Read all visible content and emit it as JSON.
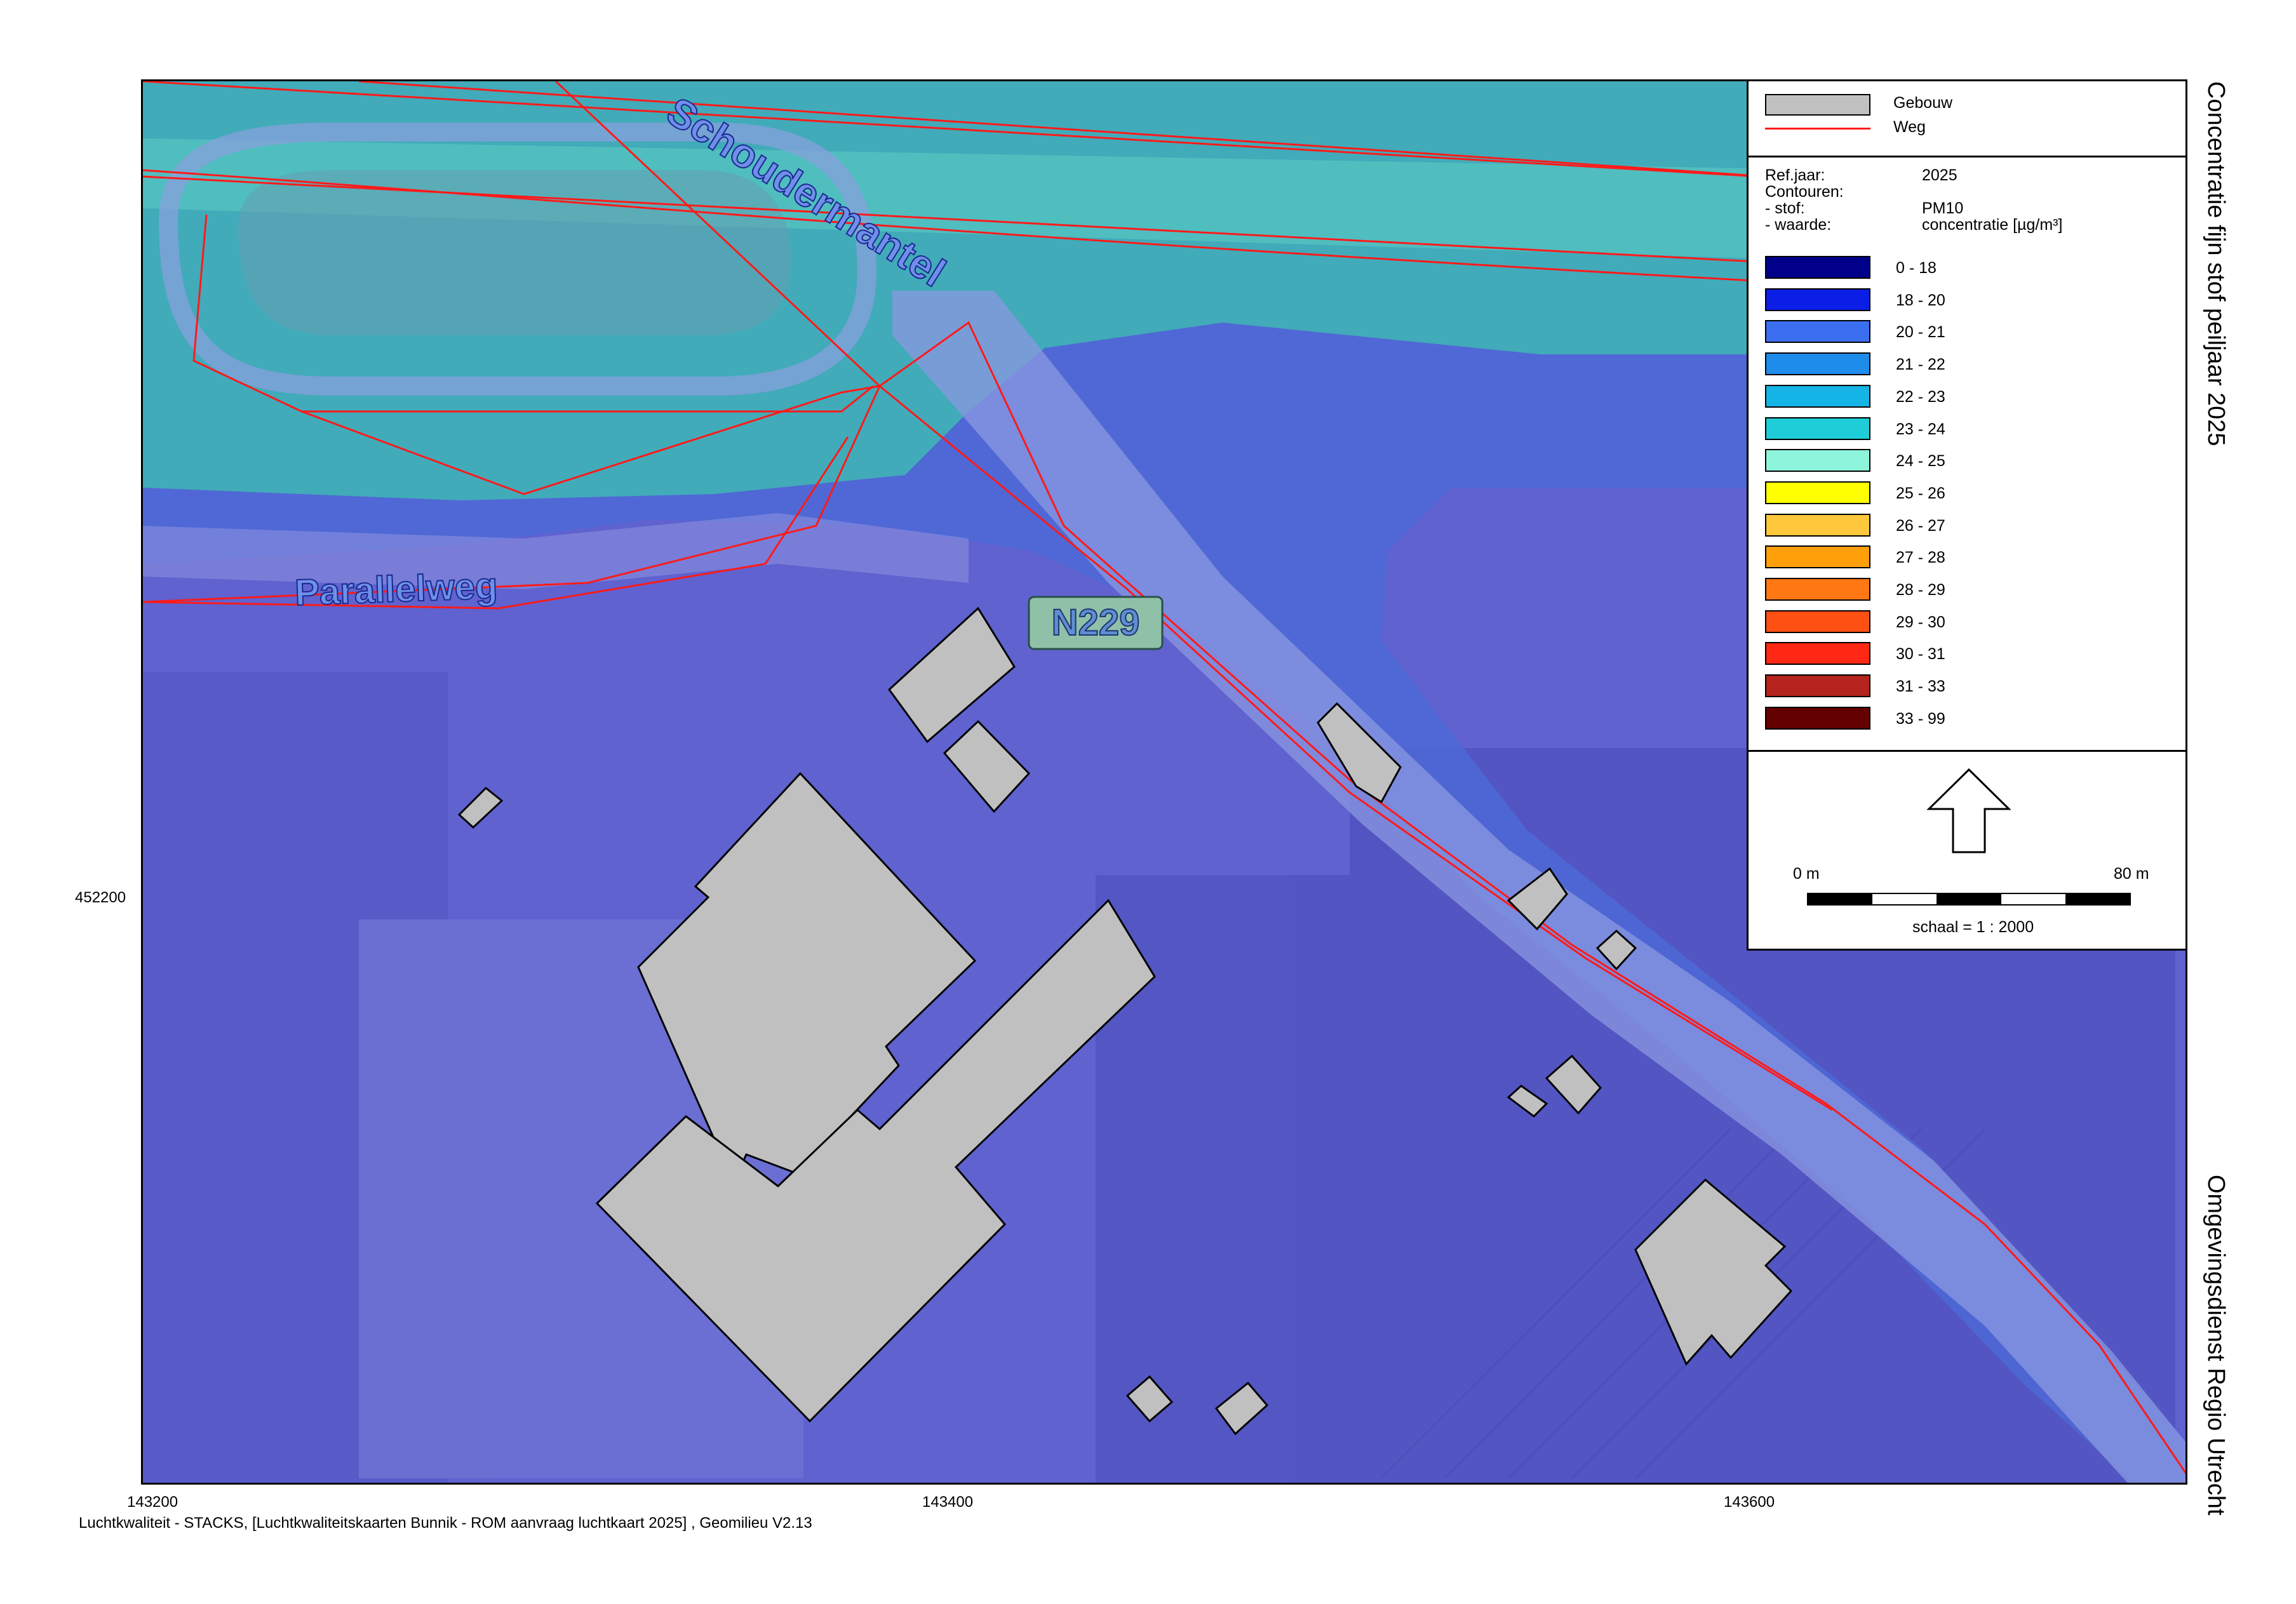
{
  "map": {
    "street_labels": [
      "Schoudermantel",
      "Parallelweg"
    ],
    "road_shield": "N229",
    "colors": {
      "background_zone": "#5f62cf",
      "high_zone": "#3fb3b6",
      "building": "#c0c0c0",
      "road": "#ff1a1a"
    }
  },
  "legend": {
    "items": [
      {
        "label": "Gebouw",
        "icon": "building-swatch"
      },
      {
        "label": "Weg",
        "icon": "road-line"
      }
    ],
    "info": [
      {
        "key": "Ref.jaar:",
        "value": "2025"
      },
      {
        "key": "Contouren:",
        "value": ""
      },
      {
        "key": "- stof:",
        "value": "PM10"
      },
      {
        "key": "- waarde:",
        "value": "concentratie [µg/m³]"
      }
    ],
    "classes": [
      {
        "range": "0 - 18",
        "color": "#00008b"
      },
      {
        "range": "18 - 20",
        "color": "#0a1ee6"
      },
      {
        "range": "20 - 21",
        "color": "#3c6ef0"
      },
      {
        "range": "21 - 22",
        "color": "#1e8ceb"
      },
      {
        "range": "22 - 23",
        "color": "#14b4e6"
      },
      {
        "range": "23 - 24",
        "color": "#1ecdd7"
      },
      {
        "range": "24 - 25",
        "color": "#8cf5dc"
      },
      {
        "range": "25 - 26",
        "color": "#ffff00"
      },
      {
        "range": "26 - 27",
        "color": "#ffc83c"
      },
      {
        "range": "27 - 28",
        "color": "#ffa00a"
      },
      {
        "range": "28 - 29",
        "color": "#ff7814"
      },
      {
        "range": "29 - 30",
        "color": "#ff5014"
      },
      {
        "range": "30 - 31",
        "color": "#ff2814"
      },
      {
        "range": "31 - 33",
        "color": "#b4231e"
      },
      {
        "range": "33 - 99",
        "color": "#640000"
      }
    ],
    "north_arrow": "north-arrow-icon",
    "scale": {
      "start": "0 m",
      "end": "80 m",
      "text": "schaal = 1 : 2000"
    }
  },
  "axes": {
    "x_ticks": [
      "143200",
      "143400",
      "143600"
    ],
    "y_ticks": [
      "452200"
    ]
  },
  "side_titles": {
    "top": "Concentratie fijn stof peiljaar 2025",
    "bottom": "Omgevingsdienst Regio Utrecht"
  },
  "footer": "Luchtkwaliteit - STACKS, [Luchtkwaliteitskaarten Bunnik - ROM aanvraag luchtkaart 2025] , Geomilieu V2.13"
}
